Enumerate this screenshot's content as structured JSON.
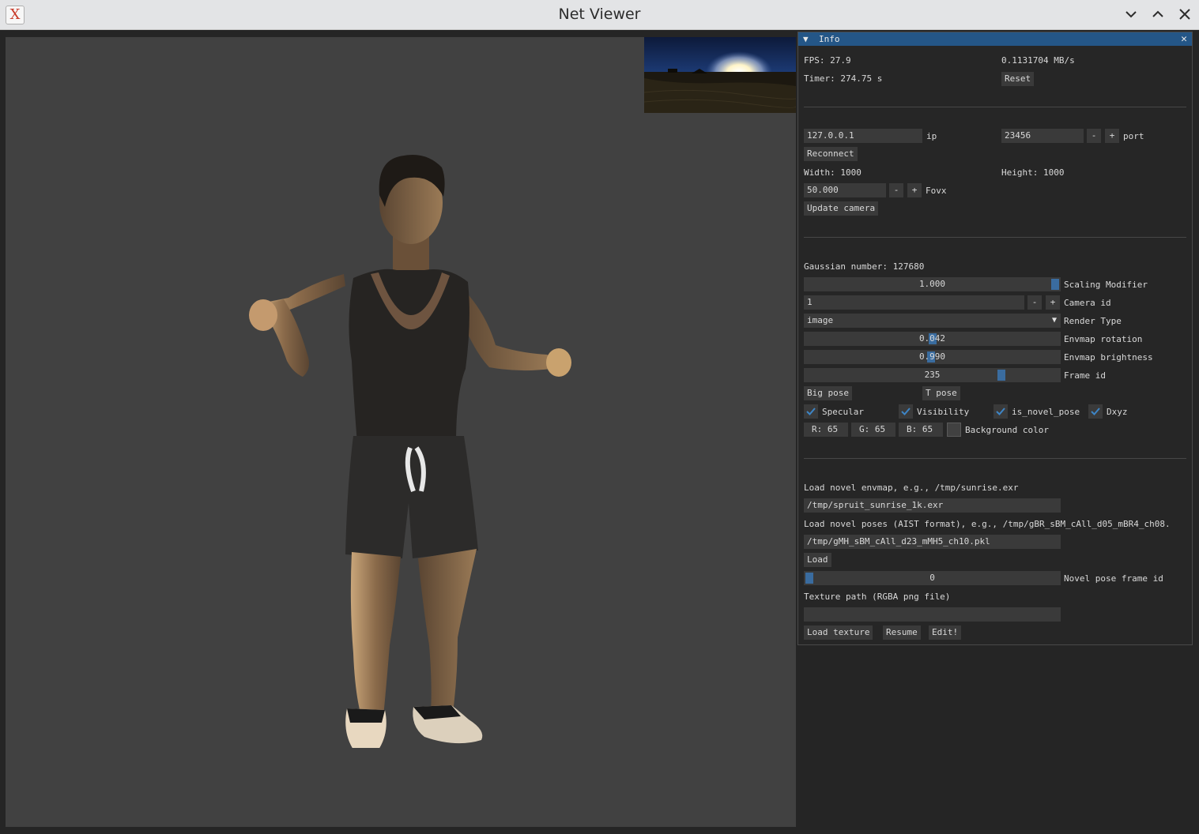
{
  "window": {
    "title": "Net Viewer"
  },
  "panel": {
    "title": "Info",
    "fps": "FPS: 27.9",
    "bandwidth": "0.1131704 MB/s",
    "timer": "Timer: 274.75 s",
    "reset": "Reset",
    "ip_value": "127.0.0.1",
    "ip_label": "ip",
    "port_value": "23456",
    "port_label": "port",
    "minus": "-",
    "plus": "+",
    "reconnect": "Reconnect",
    "width": "Width: 1000",
    "height": "Height: 1000",
    "fovx_value": "50.000",
    "fovx_label": "Fovx",
    "update_camera": "Update camera",
    "gaussian_number": "Gaussian number: 127680",
    "scaling_value": "1.000",
    "scaling_level": 1.0,
    "scaling_label": "Scaling Modifier",
    "camera_id_value": "1",
    "camera_id_label": "Camera id",
    "render_type_value": "image",
    "render_type_label": "Render Type",
    "envmap_rotation_value": "0.042",
    "envmap_rotation_level": 0.5,
    "envmap_rotation_label": "Envmap rotation",
    "envmap_brightness_value": "0.990",
    "envmap_brightness_level": 0.495,
    "envmap_brightness_label": "Envmap brightness",
    "frame_id_value": "235",
    "frame_id_level": 0.78,
    "frame_id_label": "Frame id",
    "big_pose": "Big pose",
    "t_pose": "T pose",
    "specular": "Specular",
    "visibility": "Visibility",
    "is_novel_pose": "is_novel_pose",
    "dxyz": "Dxyz",
    "r": "R: 65",
    "g": "G: 65",
    "b": "B: 65",
    "background_color": "Background color",
    "background_hex": "#414141",
    "load_envmap_label": "Load novel envmap, e.g., /tmp/sunrise.exr",
    "envmap_path": "/tmp/spruit_sunrise_1k.exr",
    "load_poses_label": "Load novel poses (AIST format), e.g., /tmp/gBR_sBM_cAll_d05_mBR4_ch08.",
    "poses_path": "/tmp/gMH_sBM_cAll_d23_mMH5_ch10.pkl",
    "load": "Load",
    "novel_frame_value": "0",
    "novel_frame_level": 0.0,
    "novel_frame_label": "Novel pose frame id",
    "texture_label": "Texture path (RGBA png file)",
    "texture_path": "",
    "load_texture": "Load texture",
    "resume": "Resume",
    "edit": "Edit!"
  },
  "colors": {
    "accent": "#245687",
    "grab": "#3a6c9f",
    "check": "#3d85c6"
  }
}
